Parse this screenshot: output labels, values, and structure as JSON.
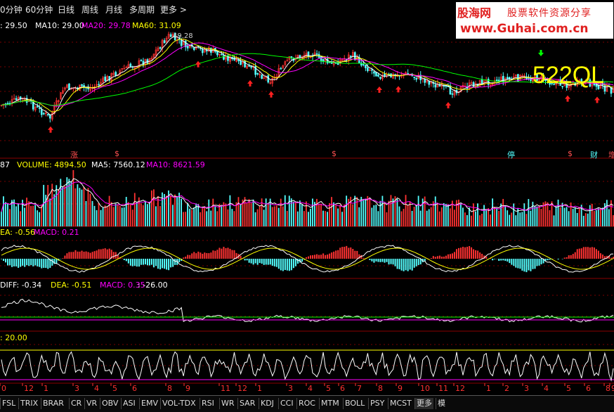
{
  "timeframes": [
    "0分钟",
    "60分钟",
    "日线",
    "周线",
    "月线",
    "多周期",
    "更多 >"
  ],
  "watermark": {
    "brand": "股海网",
    "slogan": "股票软件资源分享",
    "url": "www.Guhai.com.cn"
  },
  "main_panel": {
    "label_prefix": ":",
    "close_val": "29.50",
    "ma10": "MA10: 29.00",
    "ma20": "MA20: 29.78",
    "ma60": "MA60: 31.09",
    "peak_label": "49.28",
    "overlay_text": "522QL",
    "events": [
      "涨",
      "$",
      "$",
      "停",
      "$",
      "财",
      "增"
    ]
  },
  "volume_panel": {
    "prefix": "87",
    "volume": "VOLUME: 4894.50",
    "ma5": "MA5: 7560.12",
    "ma10": "MA10: 8621.59"
  },
  "macd_panel": {
    "dea": "EA: -0.56",
    "macd": "MACD: 0.21"
  },
  "macd2_panel": {
    "diff": "DIFF: -0.34",
    "dea": "DEA: -0.51",
    "macd": "MACD: 0.35",
    "extra": ": -26.00"
  },
  "osc_panel": {
    "value": ": 20.00"
  },
  "x_axis_labels": [
    "0",
    "12",
    "1",
    "3",
    "4",
    "5",
    "6",
    "8",
    "9",
    "11",
    "12",
    "1",
    "3",
    "4",
    "5",
    "6",
    "7",
    "8",
    "9",
    "10",
    "11",
    "12",
    "1",
    "2",
    "3",
    "4",
    "5",
    "6",
    "8",
    "9"
  ],
  "indicators": [
    "FSL",
    "TRIX",
    "BRAR",
    "CR",
    "VR",
    "OBV",
    "ASI",
    "EMV",
    "VOL-TDX",
    "RSI",
    "WR",
    "SAR",
    "KDJ",
    "CCI",
    "ROC",
    "MTM",
    "BOLL",
    "PSY",
    "MCST",
    "更多",
    "模"
  ],
  "active_indicator": "更多",
  "colors": {
    "up": "#ff3232",
    "down": "#54ffff",
    "ma10": "#ffffff",
    "ma20": "#ff00ff",
    "ma60": "#00ff00",
    "vol_ma5": "#ffffff",
    "vol_ma10": "#ff00ff",
    "grid": "#7a0000",
    "label_yellow": "#ffff00",
    "watermark_red": "#e02020"
  }
}
